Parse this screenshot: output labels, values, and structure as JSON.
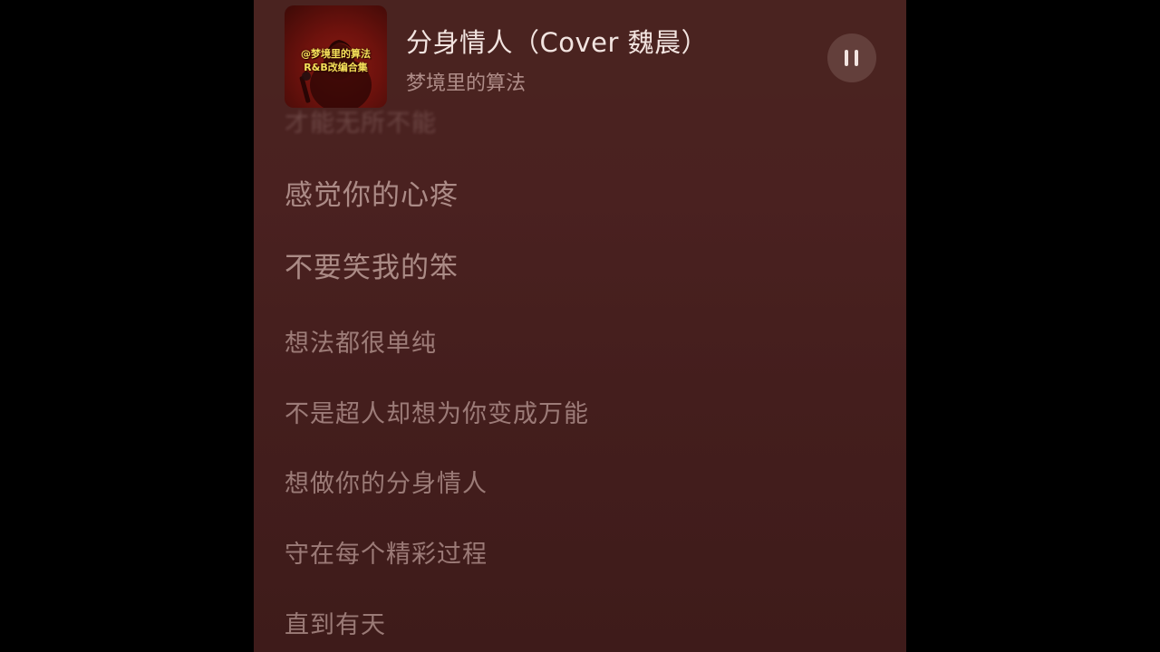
{
  "now_playing": {
    "title": "分身情人（Cover 魏晨）",
    "artist": "梦境里的算法",
    "cover_text_line1": "@梦境里的算法",
    "cover_text_line2": "R&B改编合集",
    "state": "playing",
    "pause_icon": "pause-icon"
  },
  "lyrics": {
    "lines": [
      "才能无所不能",
      "感觉你的心疼",
      "不要笑我的笨",
      "想法都很单纯",
      "不是超人却想为你变成万能",
      "想做你的分身情人",
      "守在每个精彩过程",
      "直到有天"
    ]
  },
  "colors": {
    "background": "#4a2320",
    "text_primary": "#f2e4e0",
    "text_lyric": "#e6c8c3",
    "side_bars": "#000000"
  }
}
